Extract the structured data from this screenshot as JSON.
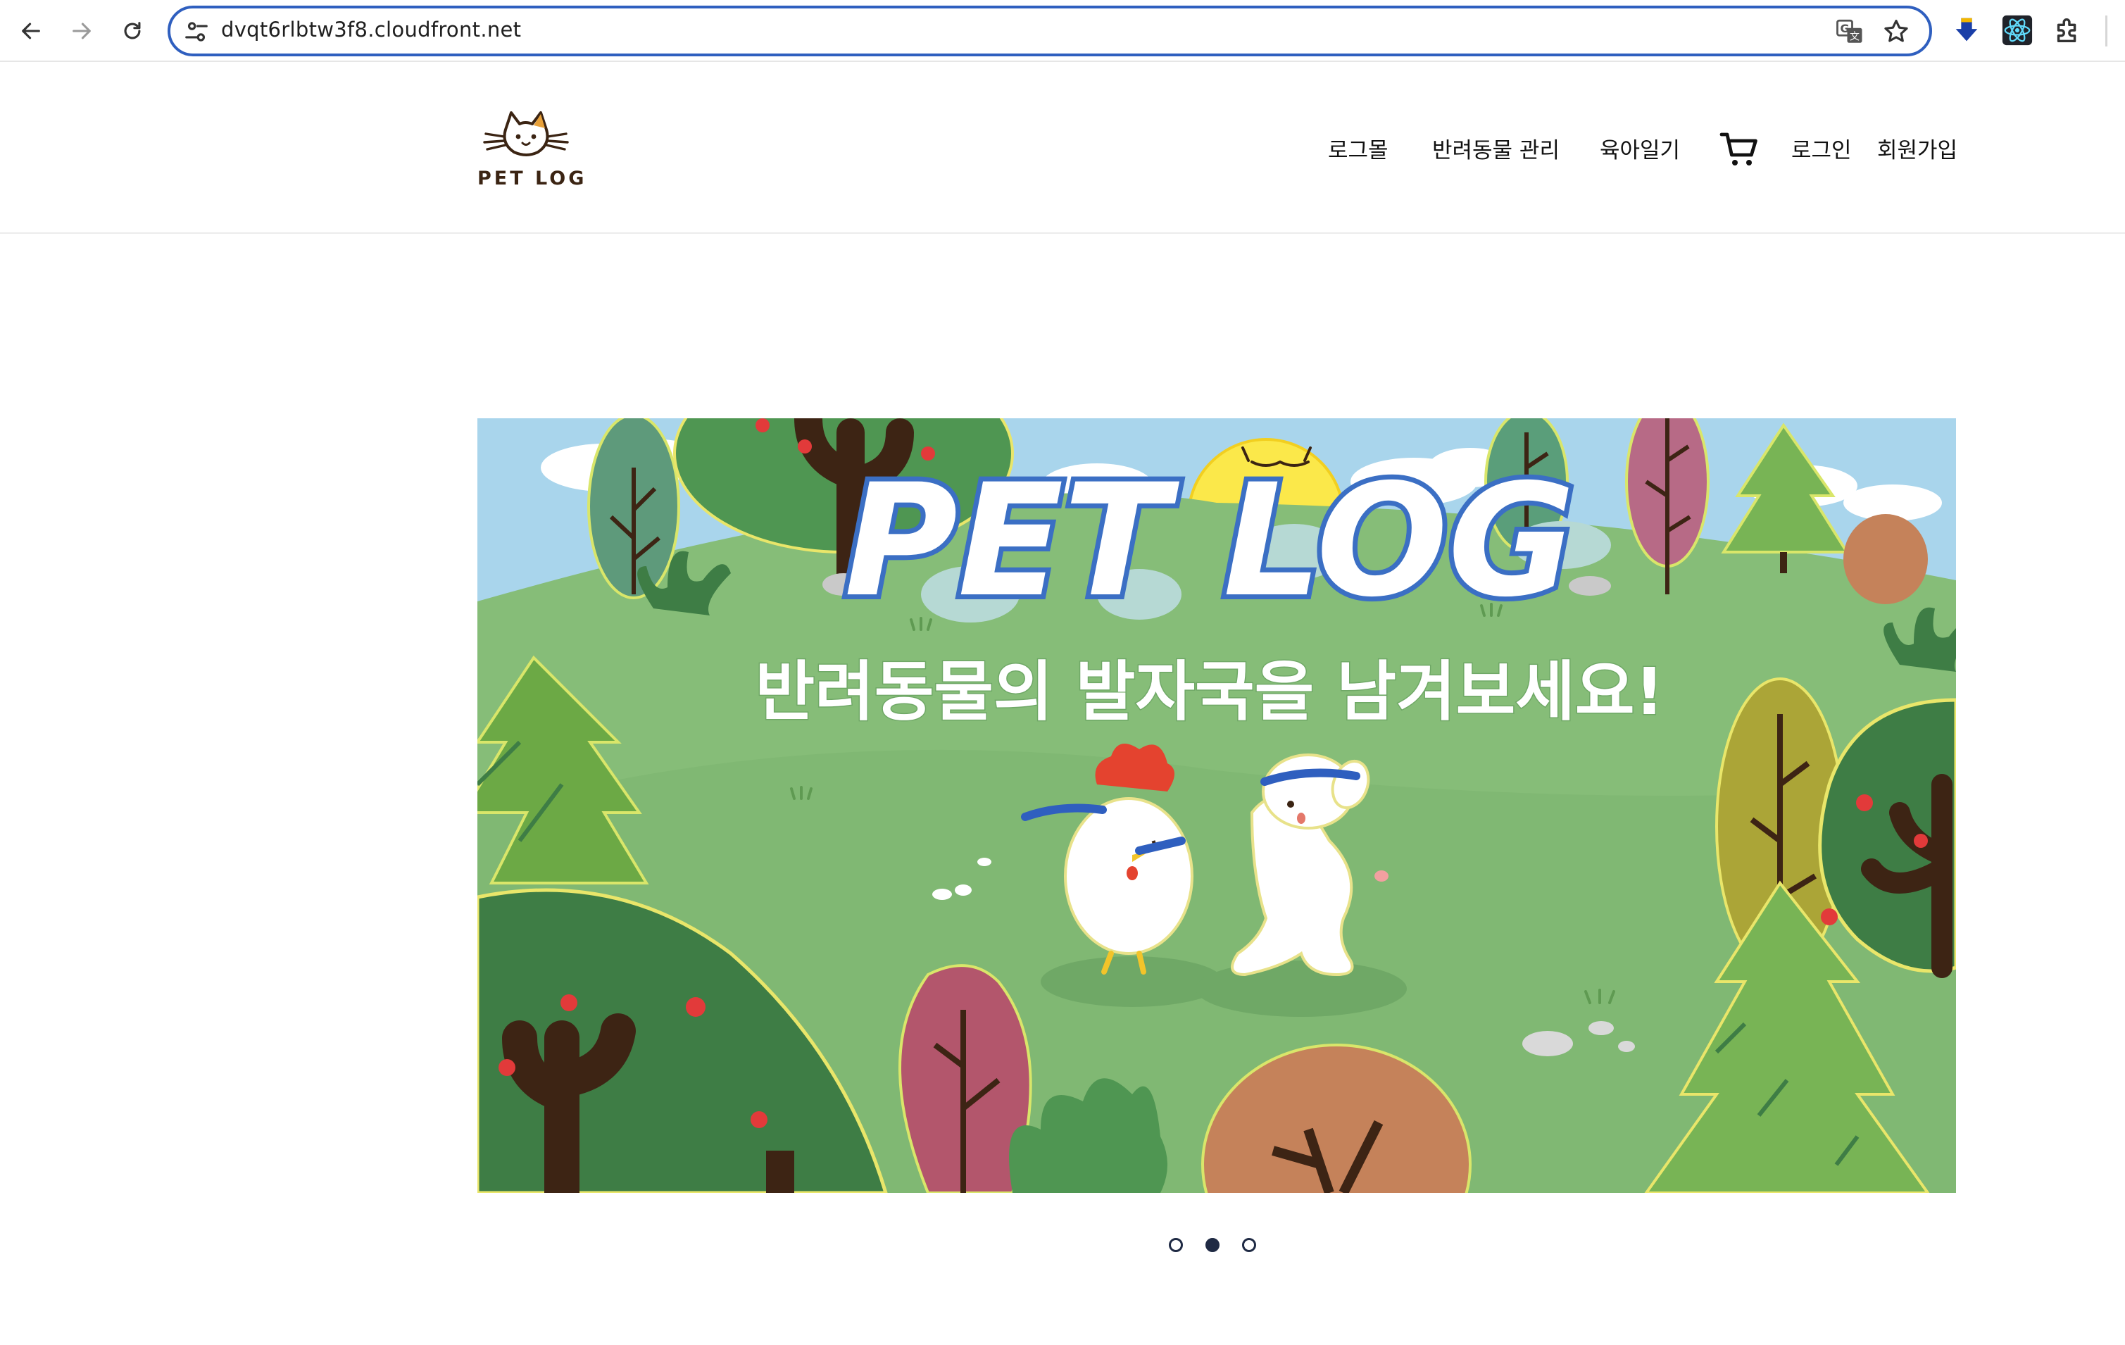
{
  "browser": {
    "url": "dvqt6rlbtw3f8.cloudfront.net"
  },
  "site": {
    "logo_text": "PET LOG",
    "nav": [
      {
        "label": "로그몰"
      },
      {
        "label": "반려동물 관리"
      },
      {
        "label": "육아일기"
      },
      {
        "label": "로그인"
      },
      {
        "label": "회원가입"
      }
    ]
  },
  "banner": {
    "title_art": "PET LOG",
    "headline": "반려동물의 발자국을 남겨보세요!",
    "colors": {
      "sky": "#a9d5ec",
      "grass": "#86bd78",
      "dark_tree": "#3e7d45",
      "trunk": "#3d2414",
      "title_fill": "#ffffff",
      "title_outline": "#3b6fc4"
    }
  },
  "carousel": {
    "slide_count": 3,
    "active_index": 1
  },
  "icons": {
    "back": "arrow-left-icon",
    "forward": "arrow-right-icon",
    "reload": "reload-icon",
    "site_info": "tune-icon",
    "translate": "translate-icon",
    "bookmark": "star-icon",
    "extension_1": "download-arrow-icon",
    "extension_2": "react-atom-icon",
    "extensions": "puzzle-icon",
    "cart": "cart-icon"
  }
}
